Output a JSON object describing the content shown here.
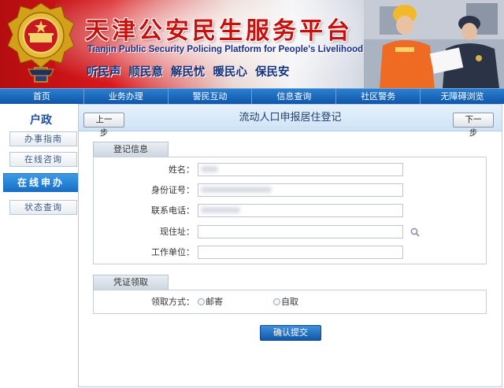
{
  "banner": {
    "title_cn": "天津公安民生服务平台",
    "title_en": "Tianjin Public Security Policing Platform for People's Livelihood",
    "slogans": [
      "听民声",
      "顺民意",
      "解民忧",
      "暖民心",
      "保民安"
    ],
    "emblem_icon": "police-emblem-icon",
    "photo": "officer-assisting-workers-photo"
  },
  "nav": {
    "items": [
      "首页",
      "业务办理",
      "警民互动",
      "信息查询",
      "社区警务",
      "无障碍浏览"
    ]
  },
  "sidebar": {
    "title": "户政",
    "items": [
      "办事指南",
      "在线咨询",
      "在线申办",
      "状态查询"
    ],
    "active_index": 2
  },
  "main": {
    "title": "流动人口申报居住登记",
    "prev_label": "上一步",
    "next_label": "下一步",
    "section_registration": {
      "tab_label": "登记信息",
      "fields": [
        {
          "label": "姓名：",
          "value": ""
        },
        {
          "label": "身份证号：",
          "value": ""
        },
        {
          "label": "联系电话：",
          "value": ""
        },
        {
          "label": "现住址：",
          "value": ""
        },
        {
          "label": "工作单位：",
          "value": ""
        }
      ]
    },
    "section_pickup": {
      "tab_label": "凭证领取",
      "method_label": "领取方式：",
      "options": [
        "邮寄",
        "自取"
      ]
    },
    "submit_label": "确认提交"
  },
  "colors": {
    "nav_blue": "#1a62b6",
    "brand_red": "#c8110d",
    "title_blue": "#1c4f9c"
  }
}
